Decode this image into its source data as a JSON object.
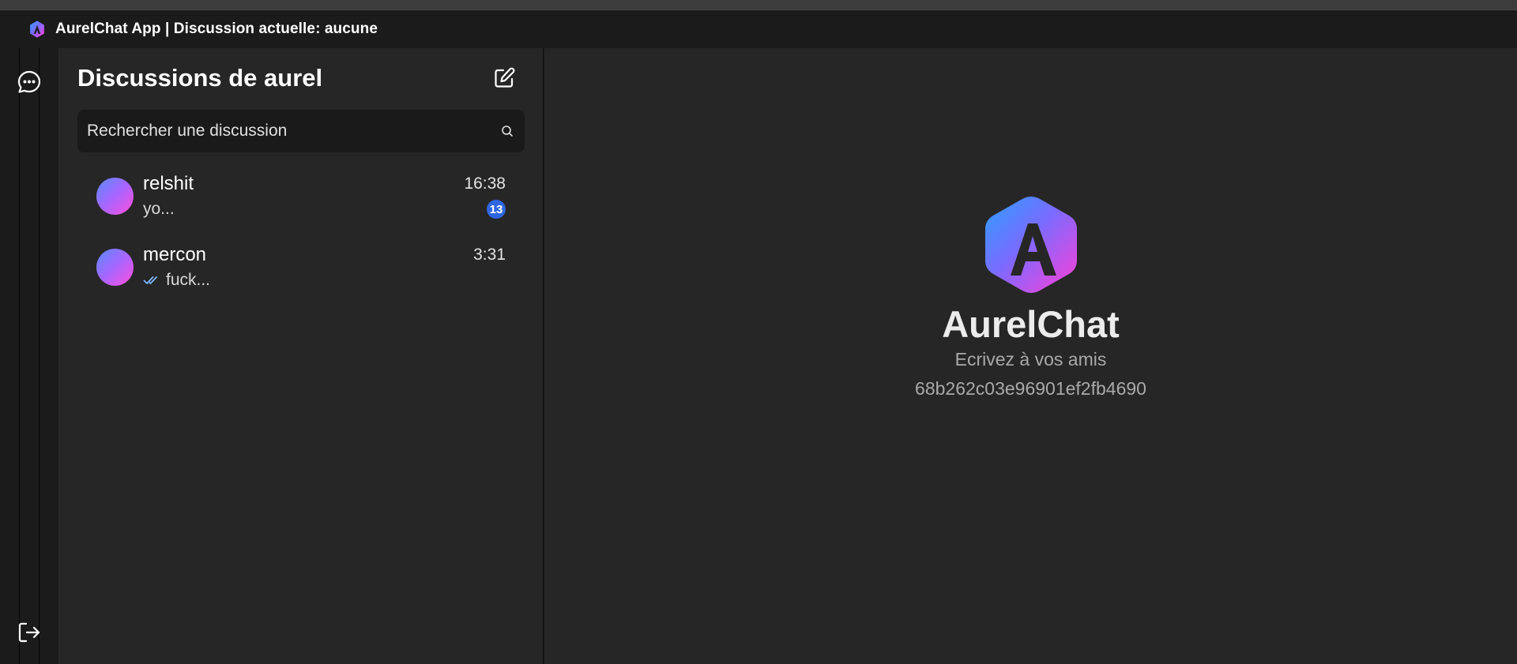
{
  "window": {
    "title": "AurelChat App | Discussion actuelle: aucune",
    "icon": "aurelchat-logo-icon"
  },
  "rail": {
    "chat_icon": "chat-bubble-icon",
    "logout_icon": "logout-icon"
  },
  "sidebar": {
    "title": "Discussions de aurel",
    "compose_icon": "compose-icon",
    "search": {
      "placeholder": "Rechercher une discussion",
      "value": ""
    },
    "conversations": [
      {
        "name": "relshit",
        "time": "16:38",
        "preview": "yo...",
        "unread": "13",
        "read_receipt": false
      },
      {
        "name": "mercon",
        "time": "3:31",
        "preview": "fuck...",
        "unread": null,
        "read_receipt": true
      }
    ]
  },
  "main": {
    "brand_name": "AurelChat",
    "tagline": "Ecrivez à vos amis",
    "user_id": "68b262c03e96901ef2fb4690"
  },
  "colors": {
    "background": "#262626",
    "titlebar": "#1b1b1b",
    "accent": "#2f66e0",
    "gradient_start": "#3a8dff",
    "gradient_end": "#ff4fd8"
  }
}
